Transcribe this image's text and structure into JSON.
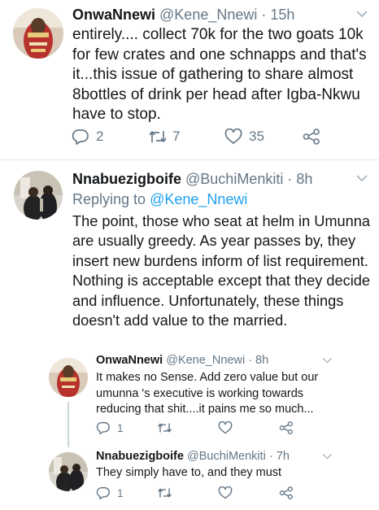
{
  "tweets": [
    {
      "author": "OnwaNnewi",
      "handle": "@Kene_Nnewi",
      "time": "· 15h",
      "text_lines": [
        "entirely.... collect 70k for the two goats 10k",
        "for few crates and one schnapps and that's",
        "it...this issue of gathering to share almost",
        "8bottles of drink per head after Igba-Nkwu",
        "have to stop."
      ],
      "replies": "2",
      "retweets": "7",
      "likes": "35"
    },
    {
      "author": "Nnabuezigboife",
      "handle": "@BuchiMenkiti",
      "time": "· 8h",
      "replying_prefix": "Replying to",
      "replying_to": "@Kene_Nnewi",
      "text_lines": [
        "The point, those who seat at helm in Umunna",
        "are usually greedy. As year passes by, they",
        "insert new burdens inform of list requirement.",
        "Nothing is acceptable except that they decide",
        "and influence. Unfortunately, these things",
        "doesn't add value to the married."
      ]
    },
    {
      "author": "OnwaNnewi",
      "handle": "@Kene_Nnewi",
      "time": "· 8h",
      "text_lines": [
        "It makes no Sense.  Add zero value but our",
        "umunna 's executive is working towards",
        "reducing that shit....it pains me so much..."
      ],
      "replies": "1"
    },
    {
      "author": "Nnabuezigboife",
      "handle": "@BuchiMenkiti",
      "time": "· 7h",
      "text_lines": [
        "They simply have to, and they must"
      ],
      "replies": "1"
    }
  ],
  "icons": {
    "reply": "reply-icon",
    "retweet": "retweet-icon",
    "like": "heart-icon",
    "share": "share-icon",
    "menu": "chevron-down-icon"
  },
  "colors": {
    "text": "#14171a",
    "secondary": "#657786",
    "link": "#1da1f2",
    "divider": "#e1e8ed"
  }
}
